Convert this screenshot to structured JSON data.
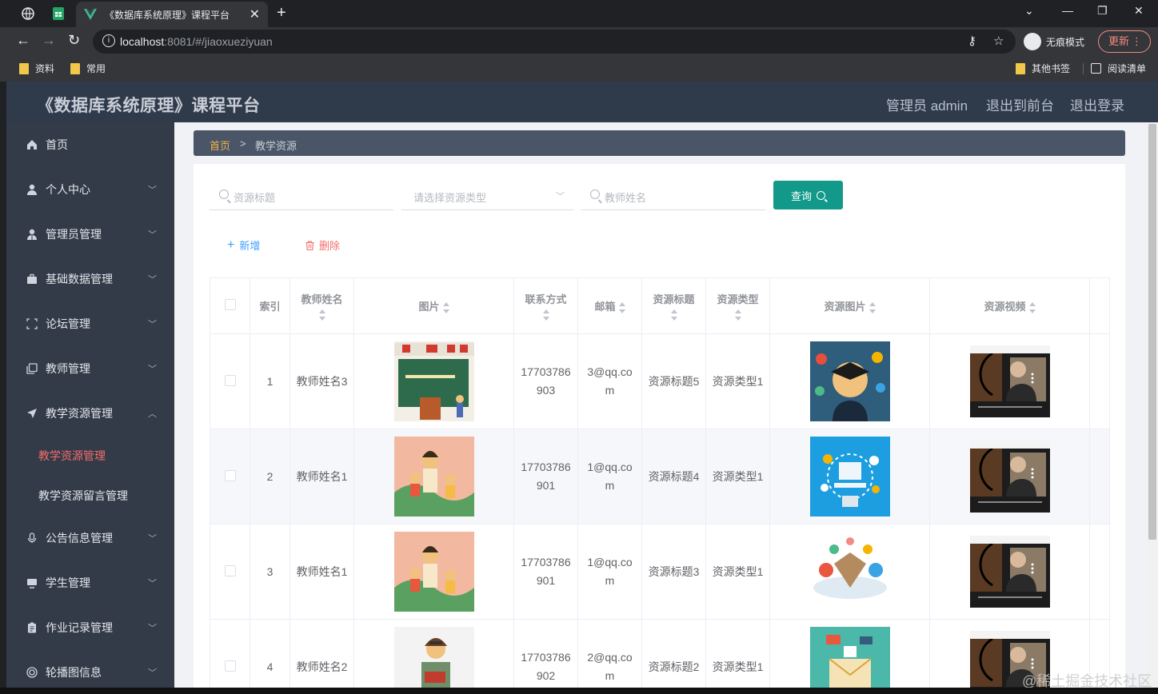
{
  "browser": {
    "tab_title": "《数据库系统原理》课程平台",
    "url_host": "localhost",
    "url_rest": ":8081/#/jiaoxueziyuan",
    "incognito_label": "无痕模式",
    "update_label": "更新",
    "bookmarks": [
      "资料",
      "常用"
    ],
    "other_bookmarks": "其他书签",
    "reading_list": "阅读清单"
  },
  "header": {
    "title": "《数据库系统原理》课程平台",
    "user": "管理员 admin",
    "to_front": "退出到前台",
    "logout": "退出登录"
  },
  "sidebar": {
    "items": [
      {
        "label": "首页",
        "icon": "home-icon"
      },
      {
        "label": "个人中心",
        "icon": "user-icon"
      },
      {
        "label": "管理员管理",
        "icon": "admin-icon"
      },
      {
        "label": "基础数据管理",
        "icon": "briefcase-icon"
      },
      {
        "label": "论坛管理",
        "icon": "frame-icon"
      },
      {
        "label": "教师管理",
        "icon": "copy-icon"
      },
      {
        "label": "教学资源管理",
        "icon": "send-icon"
      },
      {
        "label": "公告信息管理",
        "icon": "mic-icon"
      },
      {
        "label": "学生管理",
        "icon": "monitor-icon"
      },
      {
        "label": "作业记录管理",
        "icon": "clipboard-icon"
      },
      {
        "label": "轮播图信息",
        "icon": "circle-icon"
      }
    ],
    "sub_items": [
      "教学资源管理",
      "教学资源留言管理"
    ]
  },
  "breadcrumb": {
    "home": "首页",
    "sep": ">",
    "current": "教学资源"
  },
  "search": {
    "title_placeholder": "资源标题",
    "type_placeholder": "请选择资源类型",
    "teacher_placeholder": "教师姓名",
    "query_label": "查询"
  },
  "actions": {
    "add": "新增",
    "delete": "删除"
  },
  "table": {
    "headers": [
      "索引",
      "教师姓名",
      "图片",
      "联系方式",
      "邮箱",
      "资源标题",
      "资源类型",
      "资源图片",
      "资源视频"
    ],
    "rows": [
      {
        "index": "1",
        "teacher": "教师姓名3",
        "phone": "17703786903",
        "email": "3@qq.com",
        "title": "资源标题5",
        "type": "资源类型1"
      },
      {
        "index": "2",
        "teacher": "教师姓名1",
        "phone": "17703786901",
        "email": "1@qq.com",
        "title": "资源标题4",
        "type": "资源类型1"
      },
      {
        "index": "3",
        "teacher": "教师姓名1",
        "phone": "17703786901",
        "email": "1@qq.com",
        "title": "资源标题3",
        "type": "资源类型1"
      },
      {
        "index": "4",
        "teacher": "教师姓名2",
        "phone": "17703786902",
        "email": "2@qq.com",
        "title": "资源标题2",
        "type": "资源类型1"
      }
    ]
  },
  "watermark": "@稀土掘金技术社区",
  "colors": {
    "header": "#2f3a4a",
    "sidebar": "#333b48",
    "accent": "#12998a",
    "active": "#f56c6c",
    "link": "#409eff"
  }
}
